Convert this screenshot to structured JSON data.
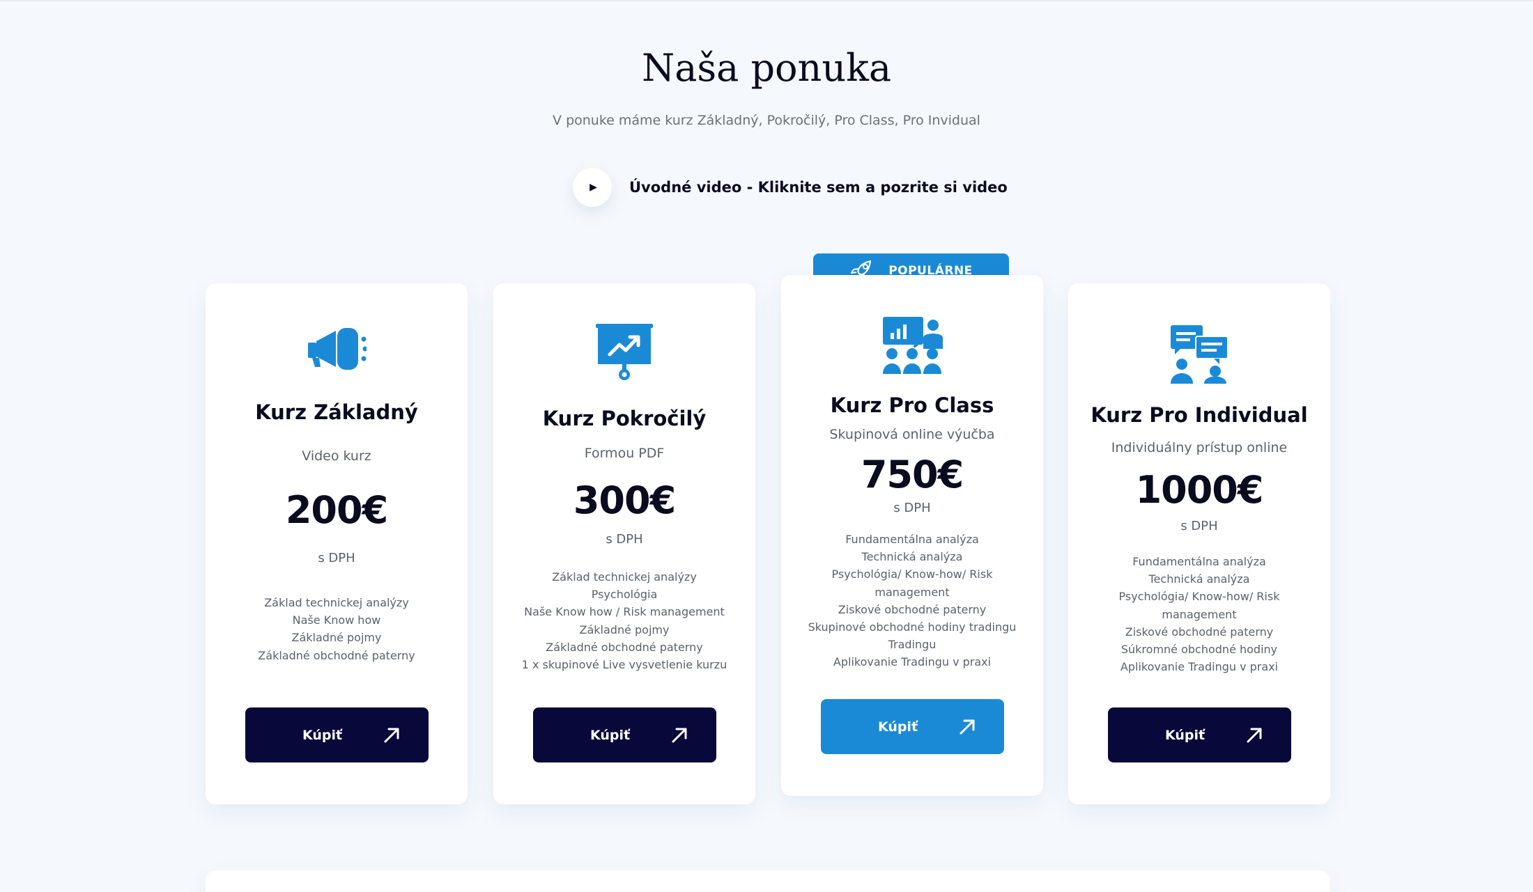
{
  "section": {
    "title": "Naša ponuka",
    "subtitle": "V ponuke máme kurz Základný, Pokročilý, Pro Class, Pro Invidual",
    "video_label": "Úvodné video - Kliknite sem a pozrite si video"
  },
  "popular_badge": "POPULÁRNE",
  "colors": {
    "accent": "#1b8ad6",
    "button_dark": "#08083a",
    "background": "#f5f9fd"
  },
  "cards": [
    {
      "icon": "megaphone-icon",
      "title": "Kurz Základný",
      "subtitle": "Video kurz",
      "price": "200€",
      "tax": "s DPH",
      "features": [
        "Základ technickej analýzy",
        "Naše Know how",
        "Základné pojmy",
        "Základné obchodné paterny"
      ],
      "button": "Kúpiť"
    },
    {
      "icon": "presentation-chart-icon",
      "title": "Kurz Pokročilý",
      "subtitle": "Formou PDF",
      "price": "300€",
      "tax": "s DPH",
      "features": [
        "Základ technickej analýzy",
        "Psychológia",
        "Naše Know how / Risk management",
        "Základné pojmy",
        "Základné obchodné paterny",
        "1 x skupinové Live vysvetlenie kurzu"
      ],
      "button": "Kúpiť"
    },
    {
      "icon": "group-class-icon",
      "title": "Kurz Pro Class",
      "subtitle": "Skupinová online výučba",
      "price": "750€",
      "tax": "s DPH",
      "features": [
        "Fundamentálna analýza",
        "Technická analýza",
        "Psychológia/ Know-how/ Risk management",
        "Ziskové obchodné paterny",
        "Skupinové obchodné hodiny tradingu Tradingu",
        "Aplikovanie Tradingu v praxi"
      ],
      "button": "Kúpiť"
    },
    {
      "icon": "individual-chat-icon",
      "title": "Kurz Pro Individual",
      "subtitle": "Individuálny prístup online",
      "price": "1000€",
      "tax": "s DPH",
      "features": [
        "Fundamentálna analýza",
        "Technická analýza",
        "Psychológia/ Know-how/ Risk management",
        "Ziskové obchodné paterny",
        "Súkromné obchodné hodiny",
        "Aplikovanie Tradingu v praxi"
      ],
      "button": "Kúpiť"
    }
  ]
}
